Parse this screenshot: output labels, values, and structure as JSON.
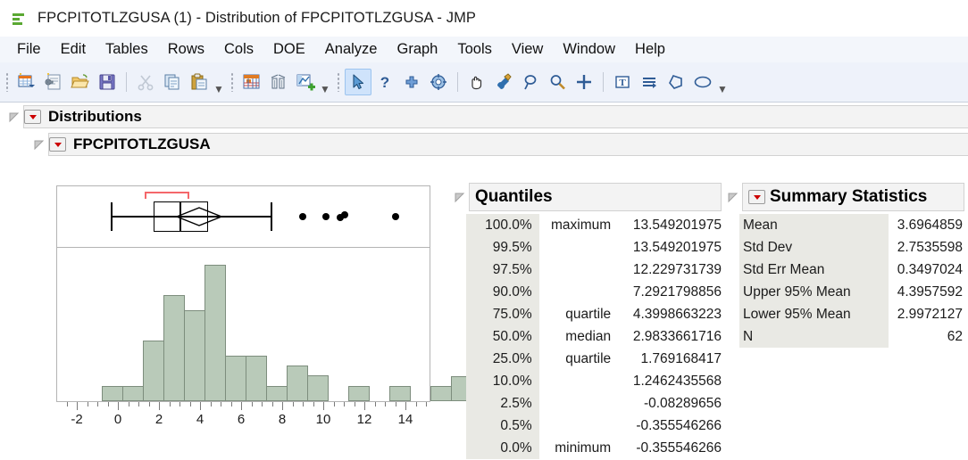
{
  "window": {
    "title": "FPCPITOTLZGUSA (1) - Distribution of FPCPITOTLZGUSA - JMP",
    "icon": "jmp-datatable-icon"
  },
  "menubar": {
    "items": [
      "File",
      "Edit",
      "Tables",
      "Rows",
      "Cols",
      "DOE",
      "Analyze",
      "Graph",
      "Tools",
      "View",
      "Window",
      "Help"
    ]
  },
  "toolbar": {
    "groups": [
      {
        "name": "file-group",
        "buttons": [
          {
            "name": "new-data-table-button",
            "icon": "new-data-table-icon",
            "enabled": true,
            "selected": false
          },
          {
            "name": "new-script-button",
            "icon": "new-script-icon",
            "enabled": true,
            "selected": false
          },
          {
            "name": "open-button",
            "icon": "open-folder-icon",
            "enabled": true,
            "selected": false
          },
          {
            "name": "save-button",
            "icon": "floppy-save-icon",
            "enabled": true,
            "selected": false
          }
        ]
      },
      {
        "name": "clipboard-group",
        "buttons": [
          {
            "name": "cut-button",
            "icon": "scissors-icon",
            "enabled": false,
            "selected": false
          },
          {
            "name": "copy-button",
            "icon": "copy-icon",
            "enabled": true,
            "selected": false
          },
          {
            "name": "paste-button",
            "icon": "paste-icon",
            "enabled": true,
            "selected": false
          }
        ]
      },
      {
        "name": "analysis-group",
        "buttons": [
          {
            "name": "data-table-button",
            "icon": "grid-table-icon",
            "enabled": true,
            "selected": false
          },
          {
            "name": "distribution-button",
            "icon": "histogram-icon",
            "enabled": true,
            "selected": false
          },
          {
            "name": "new-graph-button",
            "icon": "graph-plus-icon",
            "enabled": true,
            "selected": false
          }
        ]
      },
      {
        "name": "tools-group",
        "buttons": [
          {
            "name": "arrow-tool-button",
            "icon": "arrow-cursor-icon",
            "enabled": true,
            "selected": true
          },
          {
            "name": "help-tool-button",
            "icon": "question-mark-icon",
            "enabled": true,
            "selected": false
          },
          {
            "name": "crosshair-tool-button",
            "icon": "crosshair-plus-icon",
            "enabled": true,
            "selected": false
          },
          {
            "name": "target-tool-button",
            "icon": "target-icon",
            "enabled": true,
            "selected": false
          },
          {
            "name": "grabber-tool-button",
            "icon": "hand-icon",
            "enabled": true,
            "selected": false
          },
          {
            "name": "brush-tool-button",
            "icon": "brush-icon",
            "enabled": true,
            "selected": false
          },
          {
            "name": "lasso-tool-button",
            "icon": "lasso-icon",
            "enabled": true,
            "selected": false
          },
          {
            "name": "magnifier-tool-button",
            "icon": "magnifier-icon",
            "enabled": true,
            "selected": false
          },
          {
            "name": "crosshairs-button",
            "icon": "plus-crosshair-icon",
            "enabled": true,
            "selected": false
          }
        ]
      },
      {
        "name": "annotate-group",
        "buttons": [
          {
            "name": "text-annotate-button",
            "icon": "text-box-icon",
            "enabled": true,
            "selected": false
          },
          {
            "name": "line-annotate-button",
            "icon": "lines-arrow-icon",
            "enabled": true,
            "selected": false
          },
          {
            "name": "polygon-annotate-button",
            "icon": "polygon-icon",
            "enabled": true,
            "selected": false
          },
          {
            "name": "ellipse-annotate-button",
            "icon": "ellipse-icon",
            "enabled": true,
            "selected": false
          }
        ]
      }
    ]
  },
  "report": {
    "outline_top": "Distributions",
    "outline_variable": "FPCPITOTLZGUSA"
  },
  "quantiles": {
    "title": "Quantiles",
    "rows": [
      {
        "pct": "100.0%",
        "name": "maximum",
        "value": "13.549201975"
      },
      {
        "pct": "99.5%",
        "name": "",
        "value": "13.549201975"
      },
      {
        "pct": "97.5%",
        "name": "",
        "value": "12.229731739"
      },
      {
        "pct": "90.0%",
        "name": "",
        "value": "7.2921798856"
      },
      {
        "pct": "75.0%",
        "name": "quartile",
        "value": "4.3998663223"
      },
      {
        "pct": "50.0%",
        "name": "median",
        "value": "2.9833661716"
      },
      {
        "pct": "25.0%",
        "name": "quartile",
        "value": "1.769168417"
      },
      {
        "pct": "10.0%",
        "name": "",
        "value": "1.2462435568"
      },
      {
        "pct": "2.5%",
        "name": "",
        "value": "-0.08289656"
      },
      {
        "pct": "0.5%",
        "name": "",
        "value": "-0.355546266"
      },
      {
        "pct": "0.0%",
        "name": "minimum",
        "value": "-0.355546266"
      }
    ]
  },
  "summary_statistics": {
    "title": "Summary Statistics",
    "rows": [
      {
        "name": "Mean",
        "value": "3.6964859"
      },
      {
        "name": "Std Dev",
        "value": "2.7535598"
      },
      {
        "name": "Std Err Mean",
        "value": "0.3497024"
      },
      {
        "name": "Upper 95% Mean",
        "value": "4.3957592"
      },
      {
        "name": "Lower 95% Mean",
        "value": "2.9972127"
      },
      {
        "name": "N",
        "value": "62"
      }
    ]
  },
  "chart_data": {
    "type": "histogram",
    "title": "FPCPITOTLZGUSA",
    "xlabel": "",
    "ylabel": "",
    "xlim": [
      -2.75,
      15.25
    ],
    "xticks": [
      -2,
      0,
      2,
      4,
      6,
      8,
      10,
      12,
      14
    ],
    "xtick_labels": [
      "-2",
      "0",
      "2",
      "4",
      "6",
      "8",
      "10",
      "12",
      "14"
    ],
    "minor_tick_step": 0.5,
    "grid": false,
    "bin_width": 0.5,
    "bars": [
      {
        "x0": -0.5,
        "x1": 0.0,
        "count": 1
      },
      {
        "x0": 0.0,
        "x1": 0.5,
        "count": 1
      },
      {
        "x0": 0.5,
        "x1": 1.0,
        "count": 0
      },
      {
        "x0": 1.0,
        "x1": 1.5,
        "count": 4
      },
      {
        "x0": 1.5,
        "x1": 2.0,
        "count": 7
      },
      {
        "x0": 2.0,
        "x1": 2.5,
        "count": 6
      },
      {
        "x0": 2.5,
        "x1": 3.0,
        "count": 9
      },
      {
        "x0": 3.0,
        "x1": 3.5,
        "count": 3
      },
      {
        "x0": 3.5,
        "x1": 4.0,
        "count": 3
      },
      {
        "x0": 4.0,
        "x1": 4.5,
        "count": 1
      },
      {
        "x0": 4.5,
        "x1": 5.0,
        "count": 2
      },
      {
        "x0": 5.0,
        "x1": 5.5,
        "count": 0
      },
      {
        "x0": 5.5,
        "x1": 6.0,
        "count": 2
      },
      {
        "x0": 6.0,
        "x1": 6.5,
        "count": 0
      },
      {
        "x0": 6.5,
        "x1": 7.0,
        "count": 0
      },
      {
        "x0": 7.5,
        "x1": 8.0,
        "count": 0
      },
      {
        "x0": 9.0,
        "x1": 9.5,
        "count": 0
      },
      {
        "x0": 10.5,
        "x1": 11.0,
        "count": 0
      },
      {
        "x0": 11.0,
        "x1": 11.5,
        "count": 0
      },
      {
        "x0": 13.5,
        "x1": 14.0,
        "count": 0
      }
    ],
    "bar_fill": "#b9cab9",
    "bar_stroke": "#7d8d7d",
    "boxplot": {
      "min_whisker": -0.355546266,
      "q1": 1.769168417,
      "median": 2.9833661716,
      "q3": 4.3998663223,
      "max_whisker": 7.2921798856,
      "mean": 3.6964859,
      "mean_ci_lower": 2.9972127,
      "mean_ci_upper": 4.3957592,
      "confidence_bracket_color": "#f4676a",
      "outliers": [
        8.0,
        9.15,
        9.8,
        10.1,
        13.549201975
      ]
    }
  }
}
